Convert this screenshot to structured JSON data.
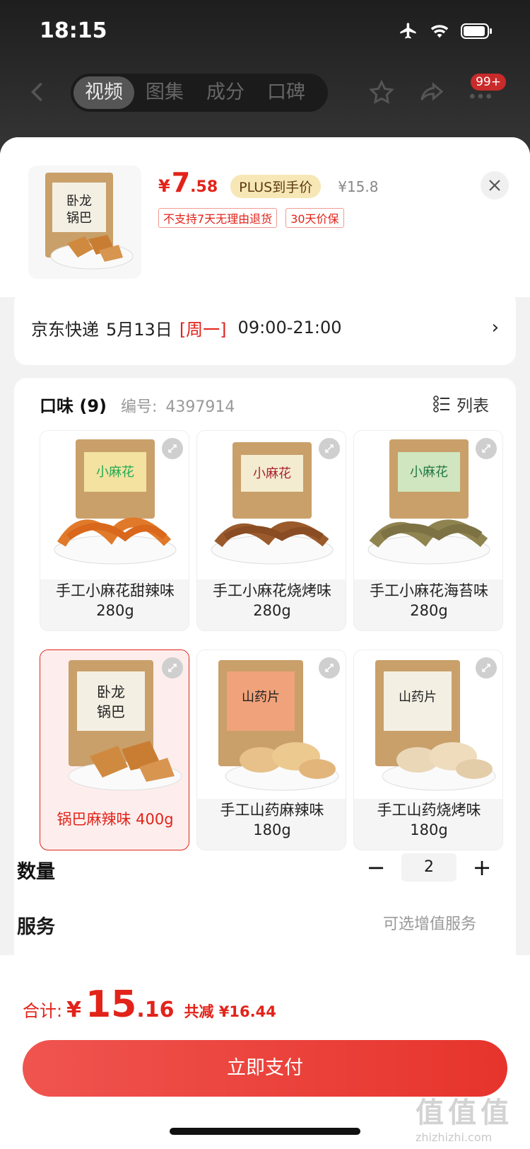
{
  "status_bar": {
    "time": "18:15"
  },
  "nav": {
    "tabs": [
      {
        "label": "视频"
      },
      {
        "label": "图集"
      },
      {
        "label": "成分"
      },
      {
        "label": "口碑"
      }
    ],
    "more_badge": "99+"
  },
  "product": {
    "price_currency": "¥",
    "price_integer": "7",
    "price_decimal": ".58",
    "plus_label": "PLUS到手价",
    "original_price": "¥15.8",
    "tags": [
      "不支持7天无理由退货",
      "30天价保"
    ]
  },
  "delivery": {
    "carrier": "京东快递",
    "date": "5月13日",
    "weekday": "[周一]",
    "time": "09:00-21:00"
  },
  "flavor": {
    "title": "口味 (9)",
    "code_label": "编号:",
    "code": "4397914",
    "list_label": "列表",
    "items": [
      {
        "name": "手工小麻花甜辣味",
        "weight": "280g"
      },
      {
        "name": "手工小麻花烧烤味",
        "weight": "280g"
      },
      {
        "name": "手工小麻花海苔味",
        "weight": "280g"
      },
      {
        "name": "锅巴麻辣味 400g",
        "weight": ""
      },
      {
        "name": "手工山药麻辣味",
        "weight": "180g"
      },
      {
        "name": "手工山药烧烤味",
        "weight": "180g"
      }
    ],
    "selected_index": 3
  },
  "quantity": {
    "label": "数量",
    "minus": "−",
    "value": "2",
    "plus": "+"
  },
  "service": {
    "label": "服务",
    "hint": "可选增值服务"
  },
  "footer": {
    "total_label": "合计:",
    "currency": "¥",
    "total_integer": "15",
    "total_decimal": ".16",
    "discount": "共减 ¥16.44",
    "pay_label": "立即支付"
  },
  "watermark": {
    "logo": "值值值",
    "url": "zhizhizhi.com"
  },
  "colors": {
    "accent": "#e2231a",
    "plus_bg": "#f7e7b6",
    "pay_gradient_start": "#f0544f",
    "pay_gradient_end": "#e6342c"
  }
}
